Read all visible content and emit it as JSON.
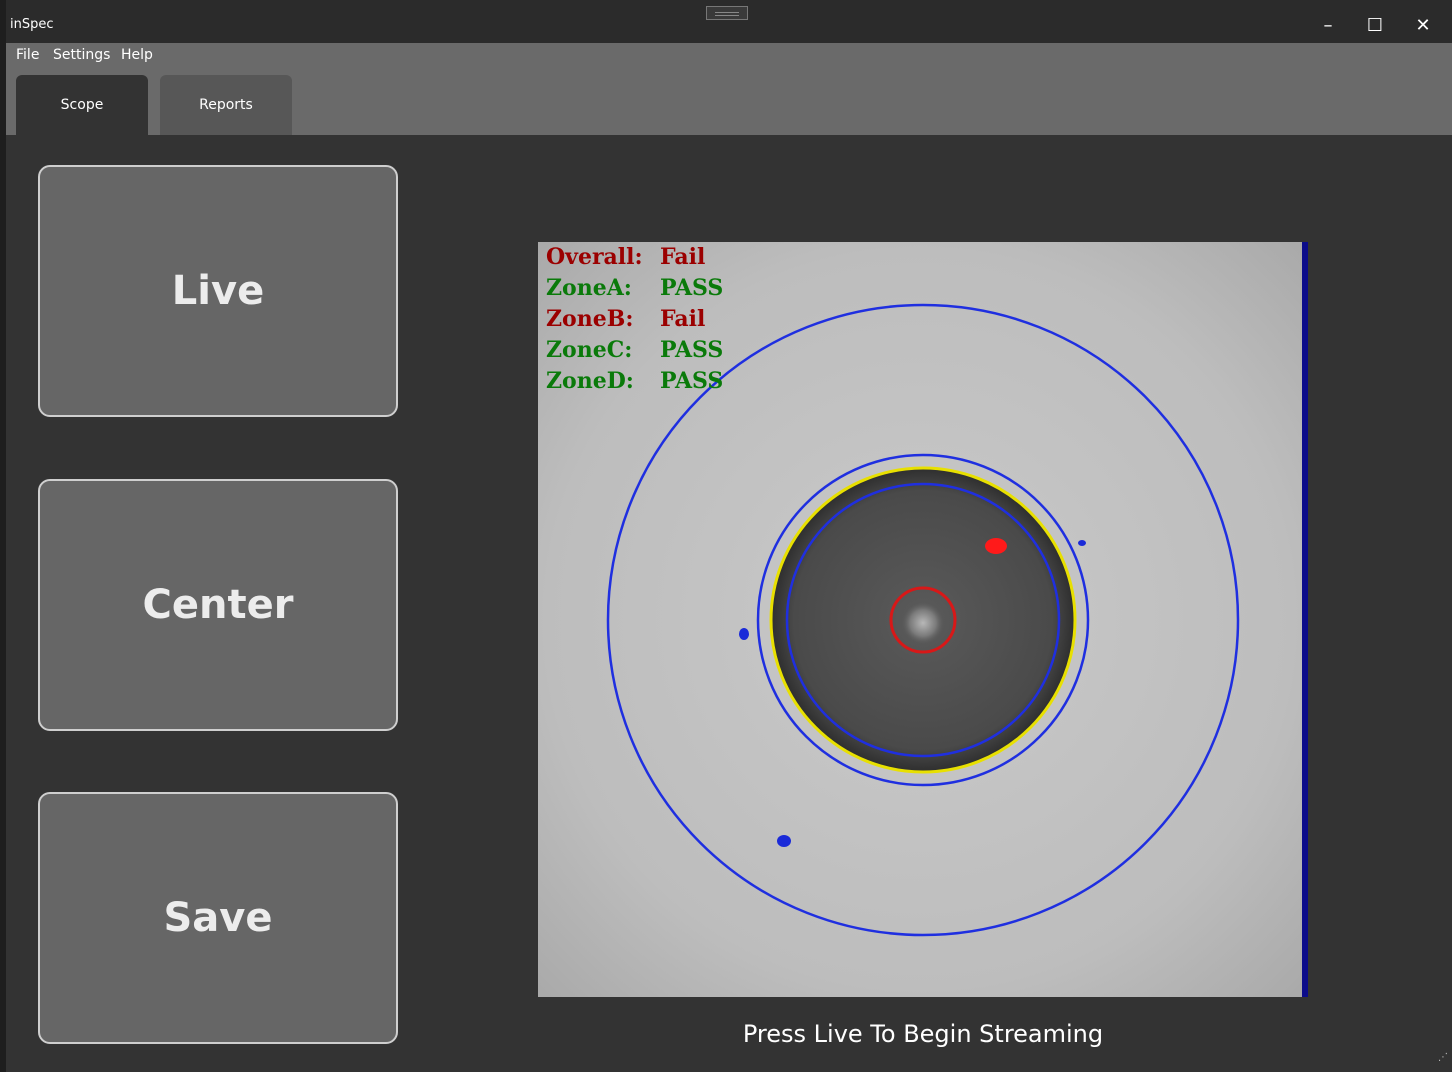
{
  "window": {
    "title": "inSpec",
    "controls": {
      "minimize": "–",
      "maximize": "☐",
      "close": "✕"
    }
  },
  "menu": {
    "items": [
      "File",
      "Settings",
      "Help"
    ]
  },
  "tabs": [
    {
      "label": "Scope",
      "active": true
    },
    {
      "label": "Reports",
      "active": false
    }
  ],
  "actions": {
    "live": "Live",
    "center": "Center",
    "save": "Save"
  },
  "results": [
    {
      "zone": "Overall:",
      "status": "Fail",
      "color": "#9b0000"
    },
    {
      "zone": "ZoneA:",
      "status": "PASS",
      "color": "#0a7a0a"
    },
    {
      "zone": "ZoneB:",
      "status": "Fail",
      "color": "#9b0000"
    },
    {
      "zone": "ZoneC:",
      "status": "PASS",
      "color": "#0a7a0a"
    },
    {
      "zone": "ZoneD:",
      "status": "PASS",
      "color": "#0a7a0a"
    }
  ],
  "overlay_colors": {
    "zone_ring": "#1f2fe0",
    "cladding_ring": "#e8e000",
    "core_ring": "#d81818",
    "defect_fail": "#ff1a1a",
    "defect_minor": "#1a2ad8"
  },
  "status_message": "Press Live To Begin Streaming"
}
